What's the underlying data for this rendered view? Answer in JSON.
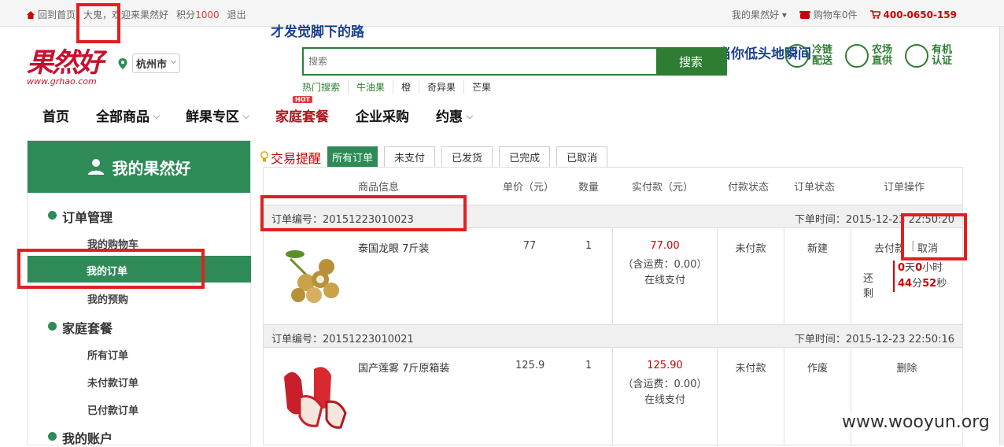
{
  "topbar": {
    "home": "回到首页",
    "user": "大鬼",
    "welcome": "，欢迎来果然好",
    "points_label": "积分",
    "points_value": "1000",
    "logout": "退出",
    "my_account": "我的果然好",
    "cart": "购物车0件",
    "phone": "400-0650-159"
  },
  "overlay": {
    "line1": "才发觉脚下的路",
    "line2": "当你低头地瞬间"
  },
  "logo": {
    "mark": "果然好",
    "url": "www.grhao.com"
  },
  "city": {
    "name": "杭州市"
  },
  "search": {
    "placeholder": "搜索",
    "button": "搜索"
  },
  "hot_search": {
    "label": "热门搜索",
    "items": [
      "牛油果",
      "橙",
      "奇异果",
      "芒果"
    ]
  },
  "badges": [
    {
      "text": "冷链配送"
    },
    {
      "text": "农场直供"
    },
    {
      "text": "有机认证"
    }
  ],
  "nav": {
    "home": "首页",
    "all": "全部商品",
    "fresh": "鲜果专区",
    "family": "家庭套餐",
    "hot_tag": "HOT",
    "enterprise": "企业采购",
    "promo": "约惠"
  },
  "sidebar": {
    "title": "我的果然好",
    "order_mgmt": "订单管理",
    "cart": "我的购物车",
    "orders": "我的订单",
    "preorder": "我的预购",
    "family": "家庭套餐",
    "all_orders": "所有订单",
    "unpaid_orders": "未付款订单",
    "paid_orders": "已付款订单",
    "account": "我的账户"
  },
  "tabs": {
    "title": "交易提醒",
    "all": "所有订单",
    "unpaid": "未支付",
    "shipped": "已发货",
    "done": "已完成",
    "cancelled": "已取消"
  },
  "table": {
    "headers": [
      "商品信息",
      "单价（元）",
      "数量",
      "实付款（元）",
      "付款状态",
      "订单状态",
      "订单操作"
    ],
    "orders": [
      {
        "no": "订单编号：20151223010023",
        "time": "下单时间：2015-12-23 22:50:20",
        "product": "泰国龙眼 7斤装",
        "price": "77",
        "qty": "1",
        "paid": "77.00",
        "shipping": "（含运费：0.00）",
        "pay_method": "在线支付",
        "pay_status": "未付款",
        "order_status": "新建",
        "action_pay": "去付款",
        "action_sep": "|",
        "action_cancel": "取消",
        "remain_label": "还剩",
        "cd_day": "0",
        "cd_day_u": "天",
        "cd_hour": "0",
        "cd_hour_u": "小时",
        "cd_min": "44",
        "cd_min_u": "分",
        "cd_sec": "52",
        "cd_sec_u": "秒"
      },
      {
        "no": "订单编号：20151223010021",
        "time": "下单时间：2015-12-23 22:50:16",
        "product": "国产莲雾 7斤原箱装",
        "price": "125.9",
        "qty": "1",
        "paid": "125.90",
        "shipping": "（含运费：0.00）",
        "pay_method": "在线支付",
        "pay_status": "未付款",
        "order_status": "作废",
        "action_delete": "删除"
      }
    ]
  },
  "watermark": "www.wooyun.org"
}
